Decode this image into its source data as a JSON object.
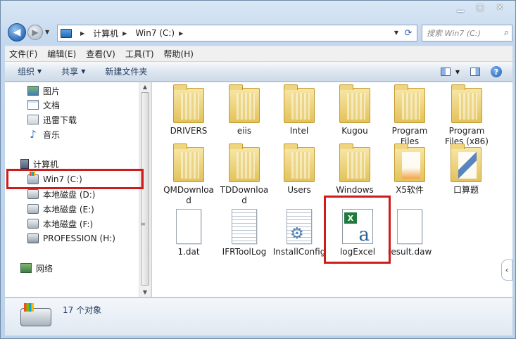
{
  "window": {
    "caption_buttons": [
      "minimize-icon",
      "maximize-icon",
      "close-icon"
    ]
  },
  "address": {
    "crumbs": [
      "计算机",
      "Win7 (C:)"
    ],
    "search_placeholder": "搜索 Win7 (C:)"
  },
  "menu": [
    "文件(F)",
    "编辑(E)",
    "查看(V)",
    "工具(T)",
    "帮助(H)"
  ],
  "commands": {
    "organize": "组织",
    "share": "共享",
    "new_folder": "新建文件夹"
  },
  "nav": {
    "favorites": [
      "图片",
      "文档",
      "迅雷下载",
      "音乐"
    ],
    "computer": "计算机",
    "drives": [
      "Win7 (C:)",
      "本地磁盘 (D:)",
      "本地磁盘 (E:)",
      "本地磁盘 (F:)",
      "PROFESSION (H:)"
    ],
    "network": "网络"
  },
  "files": [
    {
      "name": "DRIVERS",
      "type": "folder"
    },
    {
      "name": "eiis",
      "type": "folder"
    },
    {
      "name": "Intel",
      "type": "folder"
    },
    {
      "name": "Kugou",
      "type": "folder"
    },
    {
      "name": "Program Files",
      "type": "folder"
    },
    {
      "name": "Program Files (x86)",
      "type": "folder"
    },
    {
      "name": "QMDownload",
      "type": "folder"
    },
    {
      "name": "TDDownload",
      "type": "folder"
    },
    {
      "name": "Users",
      "type": "folder"
    },
    {
      "name": "Windows",
      "type": "folder"
    },
    {
      "name": "X5软件",
      "type": "folder"
    },
    {
      "name": "口算题",
      "type": "folder"
    },
    {
      "name": "1.dat",
      "type": "file"
    },
    {
      "name": "IFRToolLog",
      "type": "text"
    },
    {
      "name": "InstallConfig",
      "type": "config"
    },
    {
      "name": "logExcel",
      "type": "excel"
    },
    {
      "name": "result.daw",
      "type": "file"
    }
  ],
  "status": {
    "count": "17 个对象"
  },
  "colors": {
    "highlight": "#d11a1a",
    "accent": "#1e395b"
  }
}
